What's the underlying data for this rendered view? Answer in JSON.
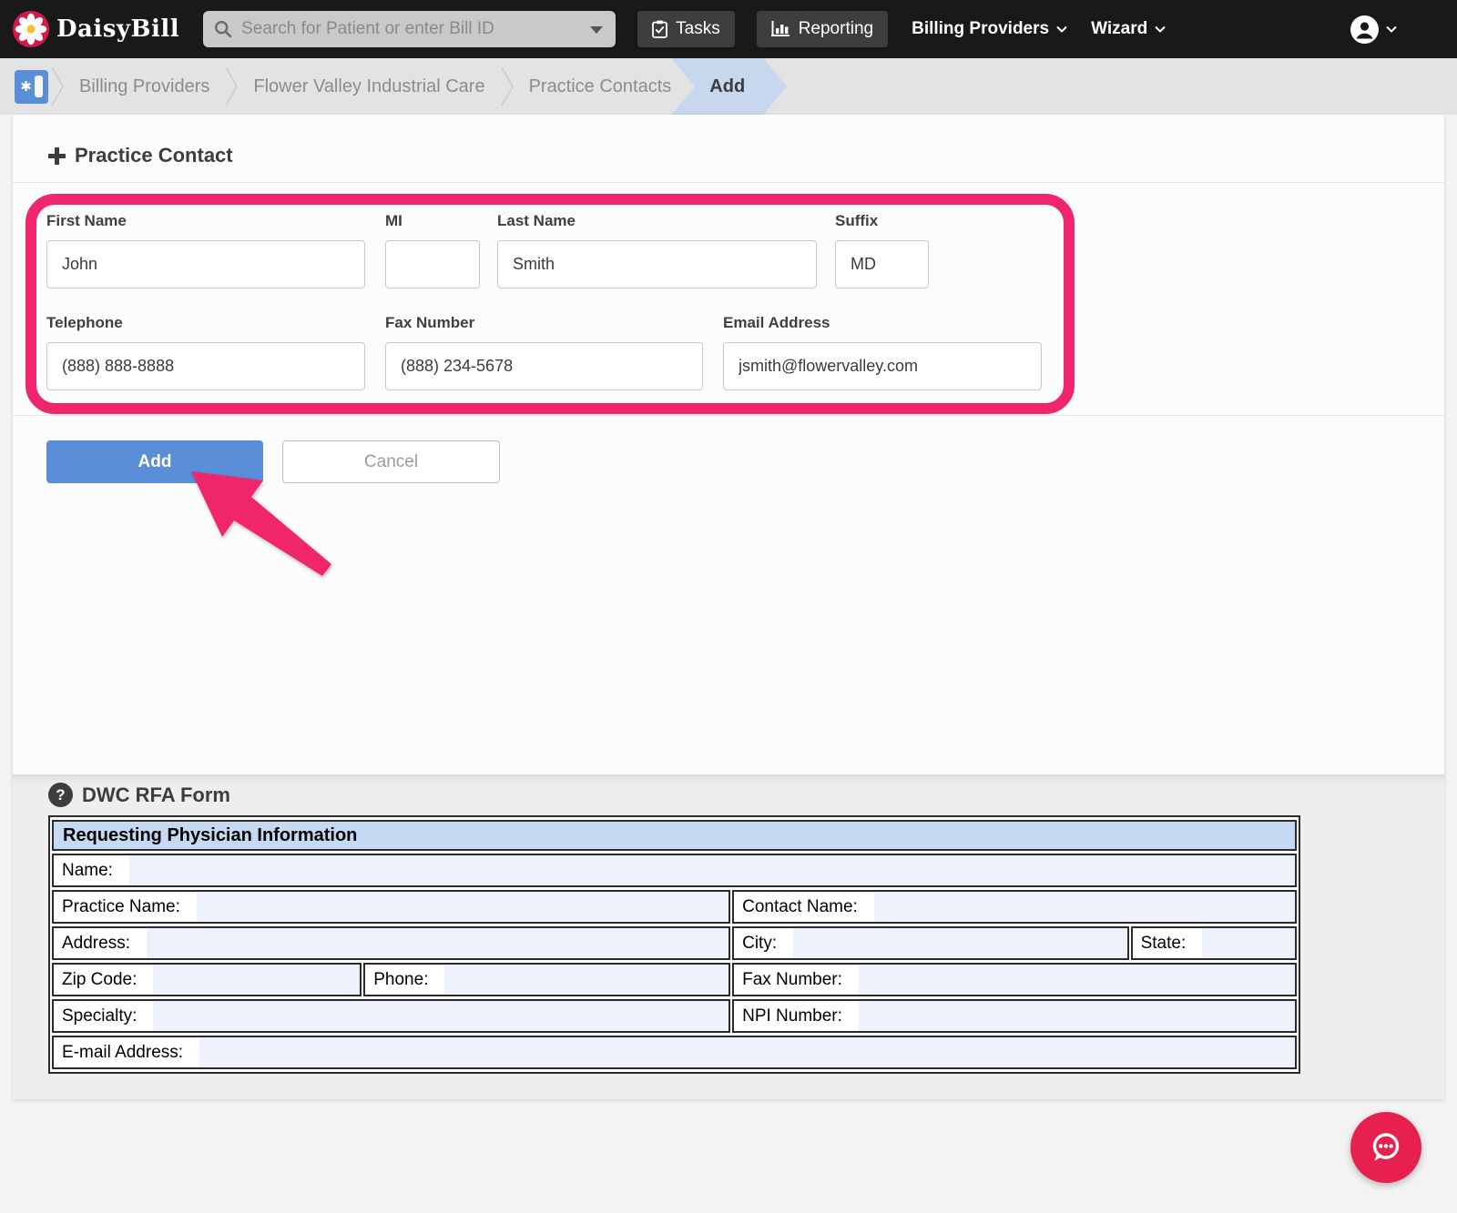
{
  "navbar": {
    "brand": "DaisyBill",
    "search_placeholder": "Search for Patient or enter Bill ID",
    "tasks_label": "Tasks",
    "reporting_label": "Reporting",
    "billing_providers_label": "Billing Providers",
    "wizard_label": "Wizard"
  },
  "breadcrumb": {
    "items": [
      {
        "label": "Billing Providers"
      },
      {
        "label": "Flower Valley Industrial Care"
      },
      {
        "label": "Practice Contacts"
      }
    ],
    "active": "Add"
  },
  "form": {
    "title": "Practice Contact",
    "fields": {
      "first_name": {
        "label": "First Name",
        "value": "John"
      },
      "mi": {
        "label": "MI",
        "value": ""
      },
      "last_name": {
        "label": "Last Name",
        "value": "Smith"
      },
      "suffix": {
        "label": "Suffix",
        "value": "MD"
      },
      "telephone": {
        "label": "Telephone",
        "value": "(888) 888-8888"
      },
      "fax": {
        "label": "Fax Number",
        "value": "(888) 234-5678"
      },
      "email": {
        "label": "Email Address",
        "value": "jsmith@flowervalley.com"
      }
    },
    "add_label": "Add",
    "cancel_label": "Cancel"
  },
  "rfa": {
    "title": "DWC RFA Form",
    "help_glyph": "?",
    "table": {
      "header": "Requesting Physician Information",
      "cells": {
        "name": "Name:",
        "practice_name": "Practice Name:",
        "contact_name": "Contact Name:",
        "address": "Address:",
        "city": "City:",
        "state": "State:",
        "zip": "Zip Code:",
        "phone": "Phone:",
        "fax": "Fax Number:",
        "specialty": "Specialty:",
        "npi": "NPI Number:",
        "email": "E-mail Address:"
      }
    }
  },
  "icons": {
    "daisy-logo-icon": "white daisy with yellow center on crimson circle",
    "search-icon": "magnifier",
    "tasks-icon": "clipboard-check",
    "reporting-icon": "bar-chart",
    "user-avatar-icon": "person-circle",
    "breadcrumb-app-icon": "blue tile with asterisk and card",
    "plus-icon": "plus",
    "help-icon": "question-circle",
    "chat-bubble-icon": "speech bubble with three dots"
  },
  "colors": {
    "navbar_bg": "#191919",
    "annotation_pink": "#F1256C",
    "primary_blue": "#5B8ED8",
    "breadcrumb_active_bg": "#C6D7EE",
    "table_header_bg": "#C6D9F2",
    "table_fill": "#EDF1FB",
    "chat_fab": "#E8204F"
  }
}
